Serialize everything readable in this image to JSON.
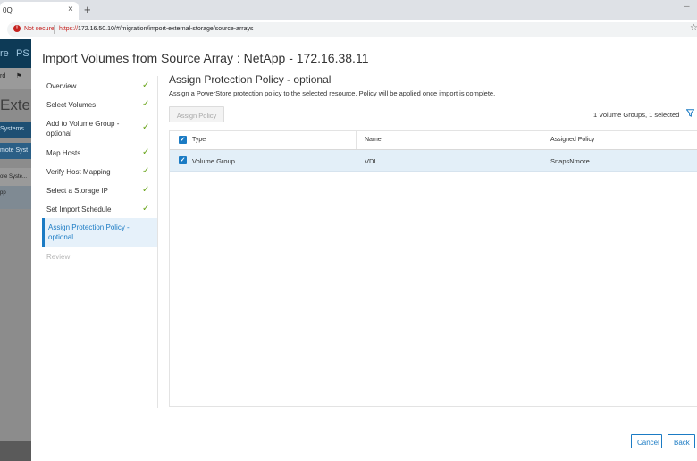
{
  "browser": {
    "tab_title": "0Q",
    "tab_close": "×",
    "new_tab": "+",
    "window_min": "–",
    "security_label": "Not secure",
    "url_scheme": "https://",
    "url_rest": "172.16.50.10/#/migration/import-external-storage/source-arrays",
    "star": "☆"
  },
  "background_app": {
    "top_a": "re",
    "top_b": "PS",
    "sub_a": "rd",
    "sub_b": "⚑",
    "big_title": "Exte",
    "systems_tab": "Systems",
    "remote_systems": "mote Syst",
    "row_1": "ote Syste...",
    "row_2": "pp"
  },
  "dialog": {
    "title": "Import Volumes from Source Array : NetApp - 172.16.38.11",
    "steps": [
      {
        "label": "Overview",
        "done": "✓"
      },
      {
        "label": "Select Volumes",
        "done": "✓"
      },
      {
        "label": "Add to Volume Group - optional",
        "done": "✓"
      },
      {
        "label": "Map Hosts",
        "done": "✓"
      },
      {
        "label": "Verify Host Mapping",
        "done": "✓"
      },
      {
        "label": "Select a Storage IP",
        "done": "✓"
      },
      {
        "label": "Set Import Schedule",
        "done": "✓"
      },
      {
        "label": "Assign Protection Policy - optional"
      },
      {
        "label": "Review"
      }
    ],
    "section_title": "Assign Protection Policy - optional",
    "section_desc": "Assign a PowerStore protection policy to the selected resource. Policy will be applied once import is complete.",
    "assign_button": "Assign Policy",
    "selection_count": "1 Volume Groups, 1 selected",
    "table": {
      "headers": {
        "type": "Type",
        "name": "Name",
        "policy": "Assigned Policy"
      },
      "rows": [
        {
          "type": "Volume Group",
          "name": "VDI",
          "policy": "SnapsNmore"
        }
      ]
    },
    "cancel_button": "Cancel",
    "back_button": "Back"
  },
  "colors": {
    "accent": "#1b7bc4",
    "check": "#6aa51c",
    "selected_row": "#e3eff8"
  }
}
